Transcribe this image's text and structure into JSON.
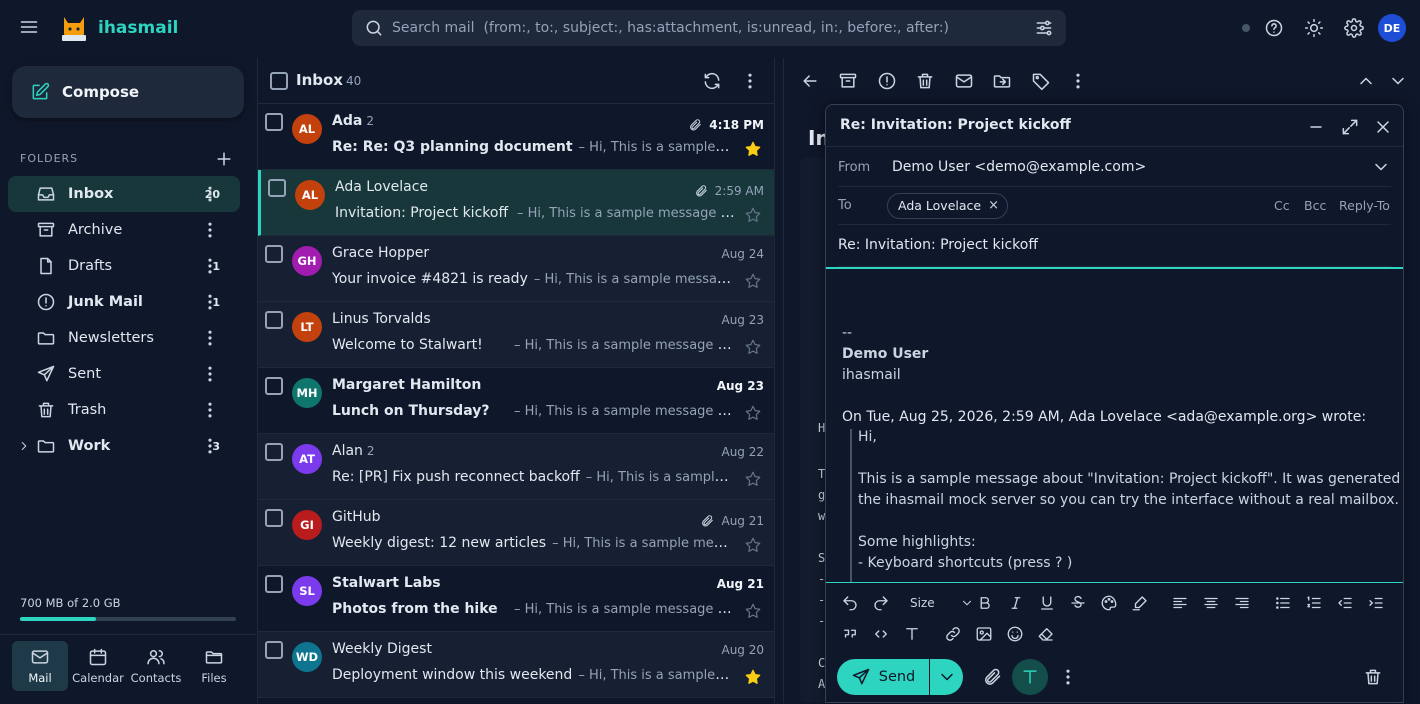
{
  "app": {
    "name": "ihasmail",
    "logo_text": "ihasmail.com",
    "user_initials": "DE"
  },
  "search": {
    "placeholder": "Search mail  (from:, to:, subject:, has:attachment, is:unread, in:, before:, after:)"
  },
  "sidebar": {
    "compose_label": "Compose",
    "folders_label": "FOLDERS",
    "folders": [
      {
        "name": "Inbox",
        "count": "20",
        "icon": "inbox-icon",
        "active": true,
        "bold": true
      },
      {
        "name": "Archive",
        "count": "",
        "icon": "archive-icon",
        "bold": false
      },
      {
        "name": "Drafts",
        "count": "1",
        "icon": "draft-icon",
        "bold": false
      },
      {
        "name": "Junk Mail",
        "count": "1",
        "icon": "junk-icon",
        "bold": true
      },
      {
        "name": "Newsletters",
        "count": "",
        "icon": "folder-icon",
        "bold": false
      },
      {
        "name": "Sent",
        "count": "",
        "icon": "send-icon",
        "bold": false
      },
      {
        "name": "Trash",
        "count": "",
        "icon": "trash-icon",
        "bold": false
      },
      {
        "name": "Work",
        "count": "3",
        "icon": "folder-icon",
        "bold": true,
        "expandable": true
      }
    ],
    "storage_text": "700 MB of 2.0 GB",
    "storage_fraction": 0.35,
    "apps": [
      {
        "label": "Mail",
        "icon": "mail-icon",
        "active": true
      },
      {
        "label": "Calendar",
        "icon": "calendar-icon"
      },
      {
        "label": "Contacts",
        "icon": "contacts-icon"
      },
      {
        "label": "Files",
        "icon": "files-icon"
      }
    ]
  },
  "list": {
    "title": "Inbox",
    "count": "40",
    "messages": [
      {
        "initials": "AL",
        "color": "#c2410c",
        "sender": "Ada",
        "thread": "2",
        "subject": "Re: Re: Q3 planning document",
        "snippet": "– Hi, This is a sample message about",
        "date": "4:18 PM",
        "attachment": true,
        "starred": true,
        "unread": true
      },
      {
        "initials": "AL",
        "color": "#c2410c",
        "sender": "Ada Lovelace",
        "thread": "",
        "subject": "Invitation: Project kickoff",
        "snippet": "– Hi, This is a sample message about",
        "date": "2:59 AM",
        "attachment": true,
        "starred": false,
        "unread": false,
        "selected": true
      },
      {
        "initials": "GH",
        "color": "#a21caf",
        "sender": "Grace Hopper",
        "thread": "",
        "subject": "Your invoice #4821 is ready",
        "snippet": "– Hi, This is a sample message about",
        "date": "Aug 24",
        "attachment": false,
        "starred": false,
        "unread": false
      },
      {
        "initials": "LT",
        "color": "#c2410c",
        "sender": "Linus Torvalds",
        "thread": "",
        "subject": "Welcome to Stalwart!",
        "snippet": "– Hi, This is a sample message about",
        "date": "Aug 23",
        "attachment": false,
        "starred": false,
        "unread": false
      },
      {
        "initials": "MH",
        "color": "#0f766e",
        "sender": "Margaret Hamilton",
        "thread": "",
        "subject": "Lunch on Thursday?",
        "snippet": "– Hi, This is a sample message about",
        "date": "Aug 23",
        "attachment": false,
        "starred": false,
        "unread": true
      },
      {
        "initials": "AT",
        "color": "#7c3aed",
        "sender": "Alan",
        "thread": "2",
        "subject": "Re: [PR] Fix push reconnect backoff",
        "snippet": "– Hi, This is a sample message about",
        "date": "Aug 22",
        "attachment": false,
        "starred": false,
        "unread": false
      },
      {
        "initials": "GI",
        "color": "#b91c1c",
        "sender": "GitHub",
        "thread": "",
        "subject": "Weekly digest: 12 new articles",
        "snippet": "– Hi, This is a sample message about",
        "date": "Aug 21",
        "attachment": true,
        "starred": false,
        "unread": false
      },
      {
        "initials": "SL",
        "color": "#7c3aed",
        "sender": "Stalwart Labs",
        "thread": "",
        "subject": "Photos from the hike",
        "snippet": "– Hi, This is a sample message about",
        "date": "Aug 21",
        "attachment": false,
        "starred": false,
        "unread": true
      },
      {
        "initials": "WD",
        "color": "#0e7490",
        "sender": "Weekly Digest",
        "thread": "",
        "subject": "Deployment window this weekend",
        "snippet": "– Hi, This is a sample message about",
        "date": "Aug 20",
        "attachment": false,
        "starred": true,
        "unread": false
      }
    ]
  },
  "reader": {
    "title_partial": "In",
    "peek_lines": [
      "H",
      "T",
      "g",
      "w",
      "S",
      "-",
      "-",
      "-",
      "C",
      "A"
    ]
  },
  "composer": {
    "title": "Re: Invitation: Project kickoff",
    "from_label": "From",
    "from_value": "Demo User <demo@example.com>",
    "to_label": "To",
    "to_chip": "Ada Lovelace",
    "cc": "Cc",
    "bcc": "Bcc",
    "reply_to": "Reply-To",
    "subject": "Re: Invitation: Project kickoff",
    "sig_sep": "--",
    "sig_name": "Demo User",
    "sig_org": "ihasmail",
    "quote_header": "On Tue, Aug 25, 2026, 2:59 AM, Ada Lovelace <ada@example.org> wrote:",
    "quote_lines": [
      "Hi,",
      "",
      "This is a sample message about \"Invitation: Project kickoff\". It was generated by",
      "the ihasmail mock server so you can try the interface without a real mailbox.",
      "",
      "Some highlights:",
      "- Keyboard shortcuts (press ? )"
    ],
    "size_label": "Size",
    "send_label": "Send"
  },
  "colors": {
    "accent": "#2dd4bf",
    "star": "#facc15",
    "background": "#0f172a"
  }
}
